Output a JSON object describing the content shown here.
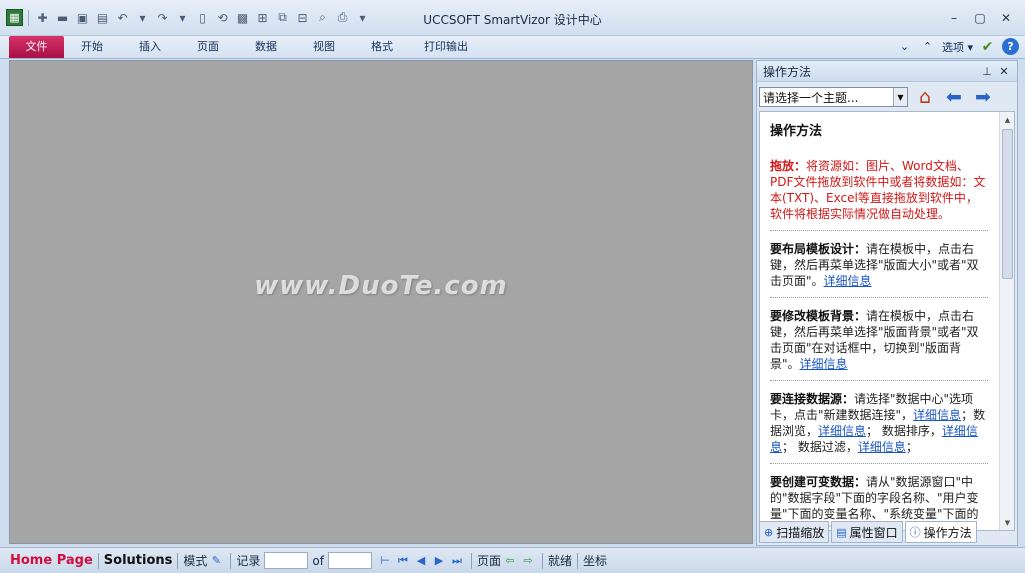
{
  "window": {
    "title": "UCCSOFT SmartVizor 设计中心"
  },
  "ribbon": {
    "tabs": [
      "文件",
      "开始",
      "插入",
      "页面",
      "数据",
      "视图",
      "格式",
      "打印输出"
    ],
    "options_label": "选项"
  },
  "canvas": {
    "watermark": "www.DuoTe.com"
  },
  "panel": {
    "title": "操作方法",
    "topic_select": "请选择一个主题...",
    "heading": "操作方法",
    "blocks": [
      {
        "bold": "拖放：",
        "text": "将资源如：图片、Word文档、PDF文件拖放到软件中或者将数据如：文本(TXT)、Excel等直接拖放到软件中，软件将根据实际情况做自动处理。"
      },
      {
        "bold": "要布局模板设计：",
        "text": "请在模板中，点击右键，然后再菜单选择\"版面大小\"或者\"双击页面\"。",
        "link": "详细信息"
      },
      {
        "bold": "要修改模板背景：",
        "text": "请在模板中，点击右键，然后再菜单选择\"版面背景\"或者\"双击页面\"在对话框中，切换到\"版面背景\"。",
        "link": "详细信息"
      },
      {
        "bold": "要连接数据源：",
        "text1": "请选择\"数据中心\"选项卡，点击\"新建数据连接\"，",
        "link1": "详细信息",
        "text2": "；数据浏览，",
        "link2": "详细信息",
        "text3": "； 数据排序，",
        "link3": "详细信息",
        "text4": "； 数据过滤，",
        "link4": "详细信息",
        "text5": "；"
      },
      {
        "bold": "要创建可变数据：",
        "text": "请从\"数据源窗口\"中的\"数据字段\"下面的字段名称、\"用户变量\"下面的变量名称、\"系统变量\"下面的变量名称拖放到模板中。"
      }
    ],
    "tabs": [
      "扫描缩放",
      "属性窗口",
      "操作方法"
    ]
  },
  "statusbar": {
    "home": "Home Page",
    "solutions": "Solutions",
    "mode": "模式",
    "record": "记录",
    "of": "of",
    "page": "页面",
    "ready": "就绪",
    "coords": "坐标"
  }
}
